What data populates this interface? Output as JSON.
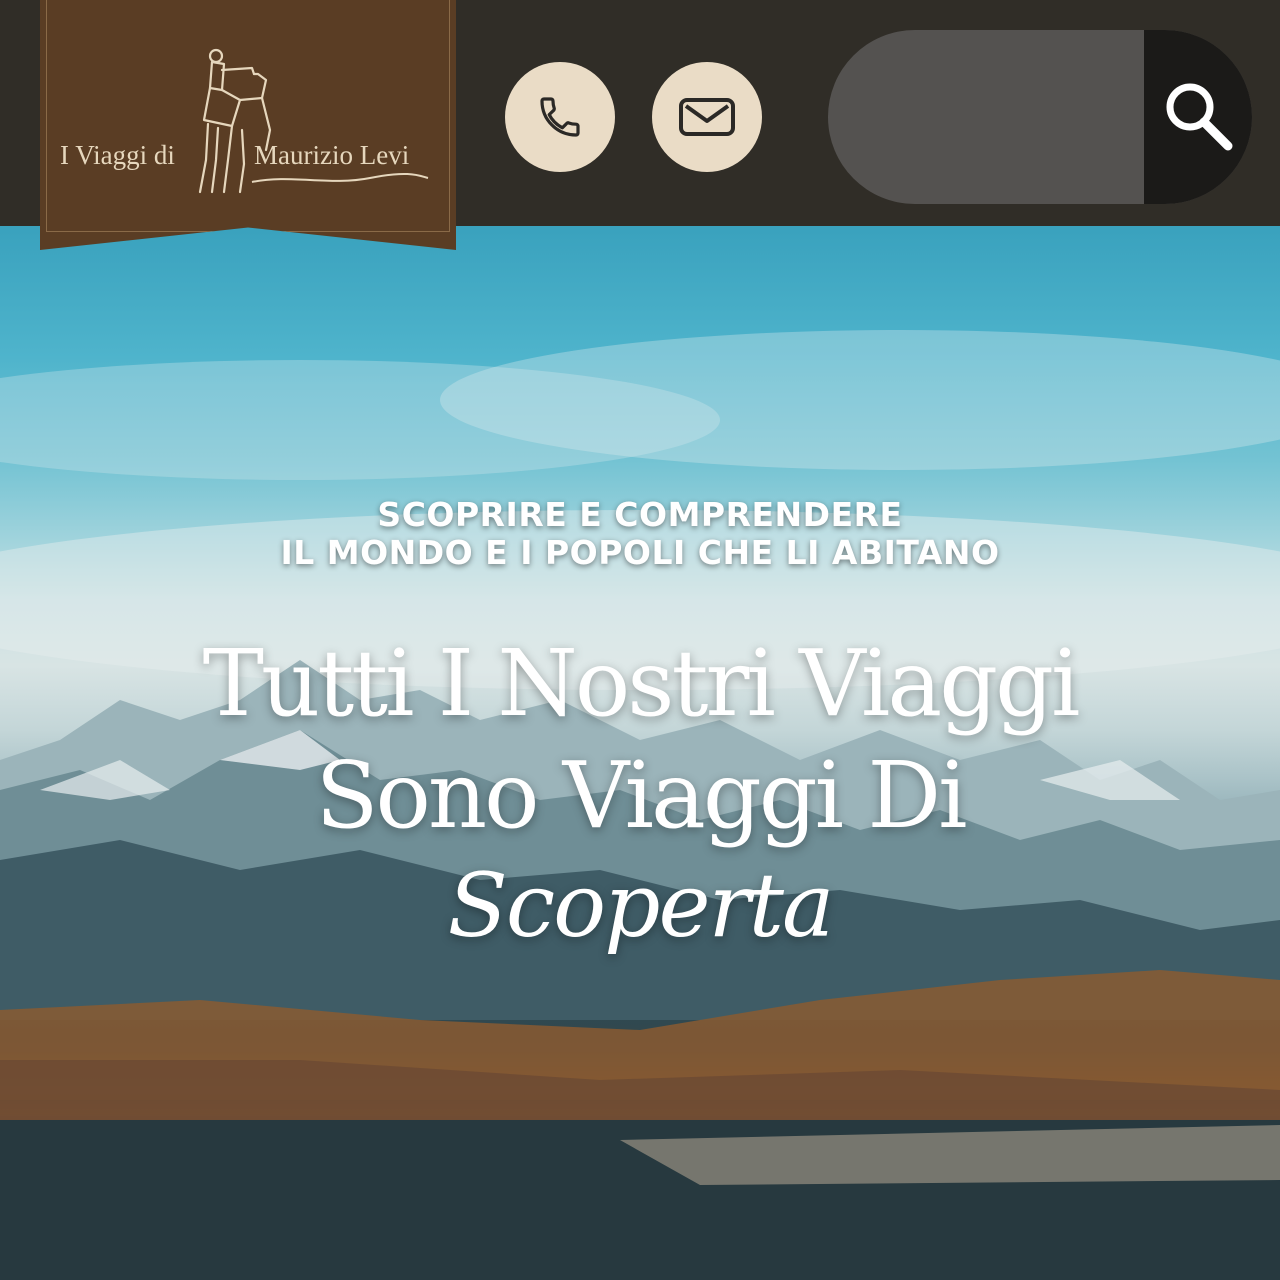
{
  "brand": {
    "name_left": "I Viaggi di",
    "name_right": "Maurizio Levi",
    "colors": {
      "banner": "#5a3d24",
      "banner_text": "#e6d7bd",
      "topbar": "#302d27"
    }
  },
  "header": {
    "phone_icon": "phone-icon",
    "mail_icon": "mail-icon",
    "search_icon": "search-icon",
    "search_value": "",
    "button_color": "#eadcc6"
  },
  "hero": {
    "tagline_line1": "SCOPRIRE E COMPRENDERE",
    "tagline_line2": "IL MONDO E I POPOLI CHE LI ABITANO",
    "headline_line1": "Tutti I Nostri Viaggi",
    "headline_line2": "Sono Viaggi Di",
    "headline_line3": "Scoperta"
  }
}
